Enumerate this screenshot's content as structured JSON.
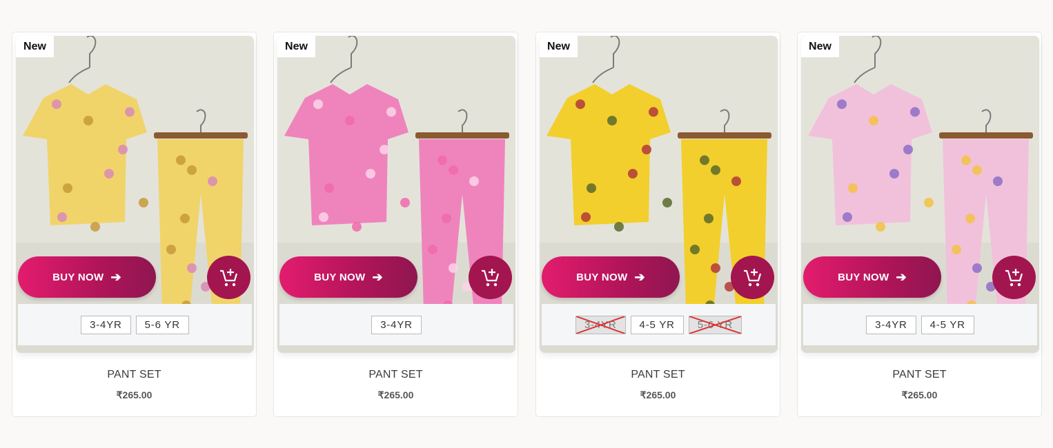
{
  "products": [
    {
      "badge": "New",
      "buy_label": "BUY NOW",
      "title": "PANT SET",
      "price": "₹265.00",
      "sizes": [
        {
          "label": "3-4YR",
          "available": true
        },
        {
          "label": "5-6 YR",
          "available": true
        }
      ],
      "print_colors": [
        "#f0d46a",
        "#d98ab6",
        "#c79a3a"
      ]
    },
    {
      "badge": "New",
      "buy_label": "BUY NOW",
      "title": "PANT SET",
      "price": "₹265.00",
      "sizes": [
        {
          "label": "3-4YR",
          "available": true
        }
      ],
      "print_colors": [
        "#ef84bd",
        "#fbd3e8",
        "#f06aaa"
      ]
    },
    {
      "badge": "New",
      "buy_label": "BUY NOW",
      "title": "PANT SET",
      "price": "₹265.00",
      "sizes": [
        {
          "label": "3-4YR",
          "available": false
        },
        {
          "label": "4-5 YR",
          "available": true
        },
        {
          "label": "5-6 YR",
          "available": false
        }
      ],
      "print_colors": [
        "#f2cf2c",
        "#b23a3a",
        "#5a6a2a"
      ]
    },
    {
      "badge": "New",
      "buy_label": "BUY NOW",
      "title": "PANT SET",
      "price": "₹265.00",
      "sizes": [
        {
          "label": "3-4YR",
          "available": true
        },
        {
          "label": "4-5 YR",
          "available": true
        }
      ],
      "print_colors": [
        "#f1c1db",
        "#8e6fc7",
        "#f3c245"
      ]
    }
  ],
  "icons": {
    "arrow": "arrow-right-icon",
    "cart": "add-to-cart-icon"
  },
  "colors": {
    "accent": "#b01459",
    "accent_light": "#e31c6e"
  }
}
